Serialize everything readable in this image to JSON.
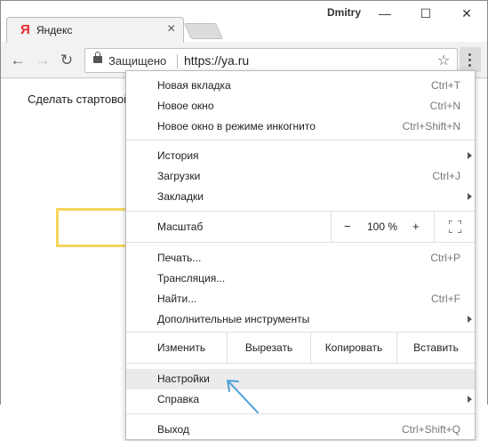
{
  "window": {
    "user": "Dmitry",
    "controls": {
      "minimize": "—",
      "maximize": "☐",
      "close": "✕"
    }
  },
  "tab": {
    "favicon": "Я",
    "title": "Яндекс",
    "close": "×"
  },
  "toolbar": {
    "back": "←",
    "forward": "→",
    "reload": "↻",
    "secure_label": "Защищено",
    "url": "https://ya.ru",
    "star": "☆"
  },
  "page": {
    "text": "Сделать стартовой"
  },
  "menu": {
    "group1": [
      {
        "label": "Новая вкладка",
        "shortcut": "Ctrl+T"
      },
      {
        "label": "Новое окно",
        "shortcut": "Ctrl+N"
      },
      {
        "label": "Новое окно в режиме инкогнито",
        "shortcut": "Ctrl+Shift+N"
      }
    ],
    "group2": [
      {
        "label": "История",
        "shortcut": ""
      },
      {
        "label": "Загрузки",
        "shortcut": "Ctrl+J"
      },
      {
        "label": "Закладки",
        "shortcut": ""
      }
    ],
    "zoom": {
      "label": "Масштаб",
      "minus": "−",
      "value": "100 %",
      "plus": "+"
    },
    "group3": [
      {
        "label": "Печать...",
        "shortcut": "Ctrl+P"
      },
      {
        "label": "Трансляция...",
        "shortcut": ""
      },
      {
        "label": "Найти...",
        "shortcut": "Ctrl+F"
      },
      {
        "label": "Дополнительные инструменты",
        "shortcut": ""
      }
    ],
    "edit": {
      "label": "Изменить",
      "cut": "Вырезать",
      "copy": "Копировать",
      "paste": "Вставить"
    },
    "settings": {
      "label": "Настройки"
    },
    "help": {
      "label": "Справка"
    },
    "exit": {
      "label": "Выход",
      "shortcut": "Ctrl+Shift+Q"
    }
  },
  "colors": {
    "accent_arrow": "#4a9fd8",
    "highlight": "#ebebeb",
    "yandex_red": "#e8272b"
  }
}
